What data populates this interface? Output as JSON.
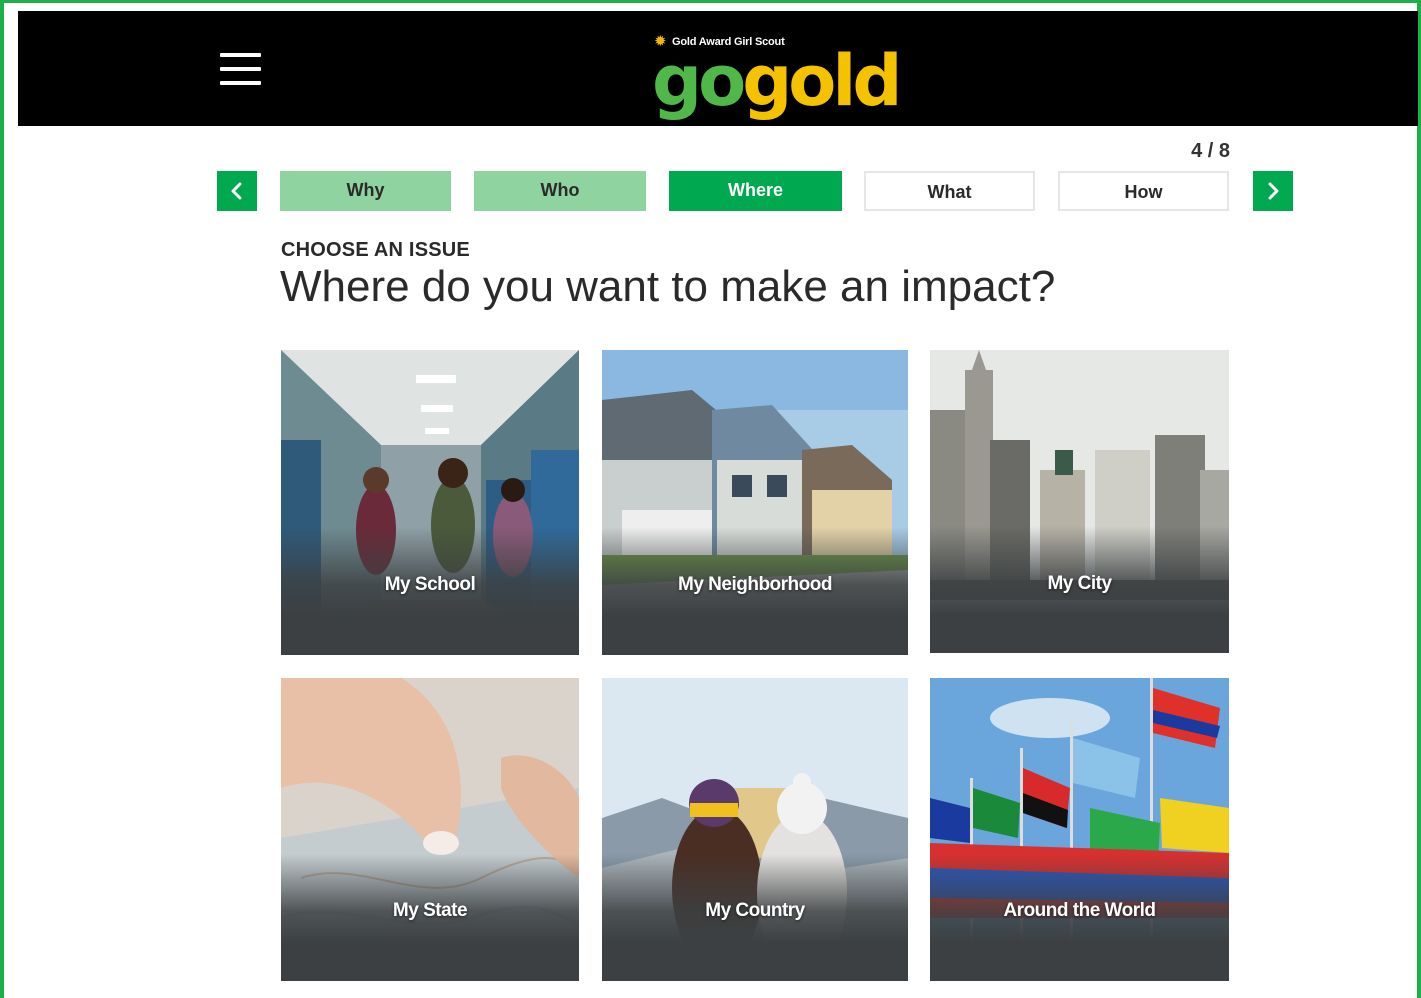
{
  "header": {
    "menu_icon": "hamburger-menu-icon",
    "logo": {
      "tagline": "Gold Award Girl Scout",
      "word_go": "go",
      "word_gold": "gold"
    }
  },
  "progress": {
    "counter": "4 / 8",
    "prev_icon": "chevron-left-icon",
    "next_icon": "chevron-right-icon",
    "steps": [
      {
        "label": "Why",
        "state": "completed"
      },
      {
        "label": "Who",
        "state": "completed"
      },
      {
        "label": "Where",
        "state": "active"
      },
      {
        "label": "What",
        "state": "upcoming"
      },
      {
        "label": "How",
        "state": "upcoming"
      }
    ]
  },
  "main": {
    "eyebrow": "CHOOSE AN ISSUE",
    "headline": "Where do you want to make an impact?",
    "options": [
      {
        "label": "My School"
      },
      {
        "label": "My Neighborhood"
      },
      {
        "label": "My City"
      },
      {
        "label": "My State"
      },
      {
        "label": "My Country"
      },
      {
        "label": "Around the World"
      }
    ]
  },
  "colors": {
    "brand_green": "#00a84f",
    "completed_green": "#8fd4a0",
    "logo_green": "#4fb848",
    "logo_gold": "#f5c200",
    "header_black": "#000000",
    "frame_green": "#1eb048"
  }
}
